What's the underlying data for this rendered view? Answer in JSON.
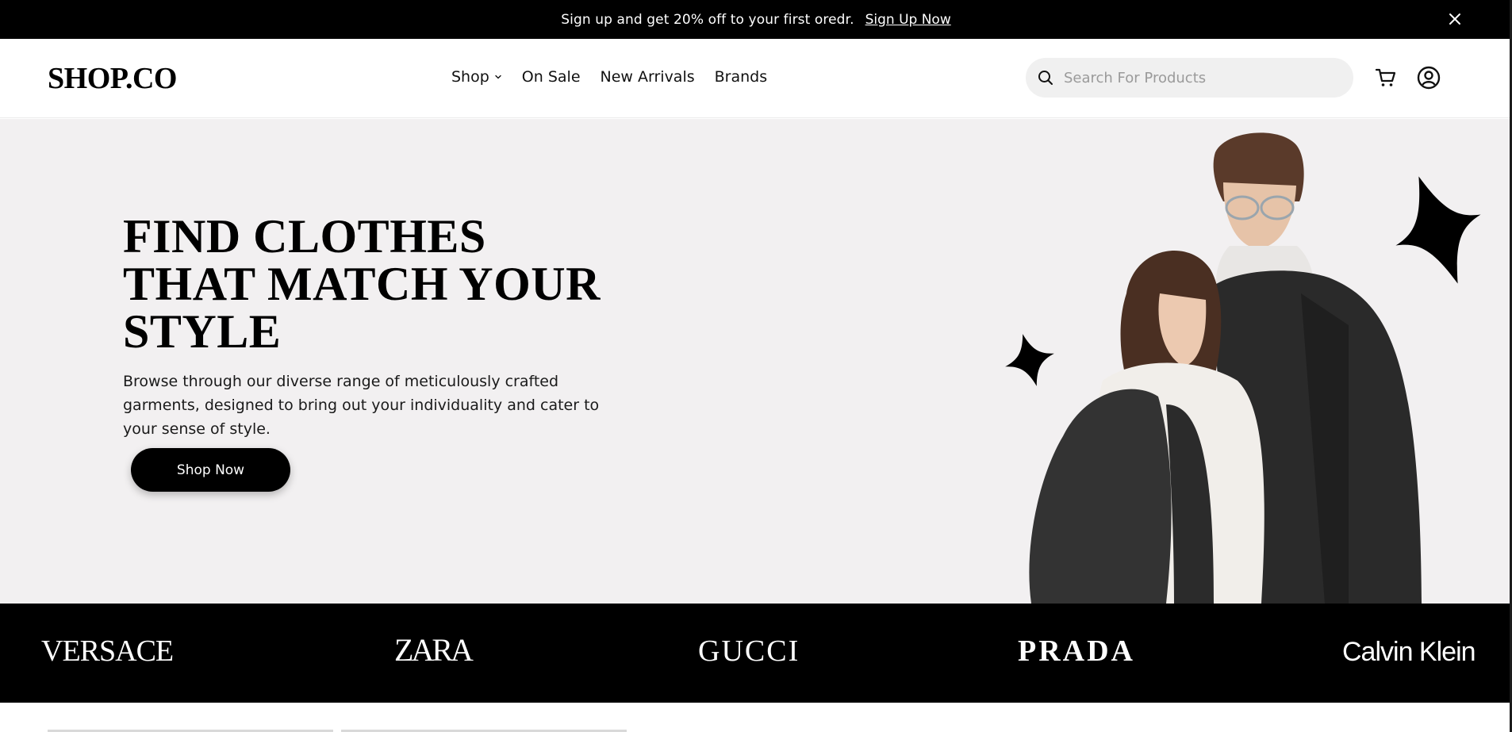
{
  "announcement": {
    "text": "Sign up and get 20% off to your first oredr.",
    "link_label": "Sign Up Now",
    "close_icon": "close-icon"
  },
  "header": {
    "logo": "SHOP.CO",
    "nav": [
      {
        "label": "Shop",
        "has_dropdown": true
      },
      {
        "label": "On Sale"
      },
      {
        "label": "New Arrivals"
      },
      {
        "label": "Brands"
      }
    ],
    "search_placeholder": "Search For Products",
    "icons": [
      "search-icon",
      "cart-icon",
      "account-icon"
    ]
  },
  "hero": {
    "title_lines": [
      "FIND CLOTHES",
      "THAT MATCH YOUR",
      "STYLE"
    ],
    "description": "Browse through our diverse range of meticulously crafted garments, designed to bring out your individuality and cater to your sense of style.",
    "cta_label": "Shop Now",
    "background_color": "#f2f0f1"
  },
  "brands": [
    "VERSACE",
    "ZARA",
    "GUCCI",
    "PRADA",
    "Calvin Klein"
  ],
  "colors": {
    "primary": "#000000",
    "surface": "#ffffff",
    "hero_bg": "#f2f0f1",
    "search_bg": "#f0f0f0"
  }
}
